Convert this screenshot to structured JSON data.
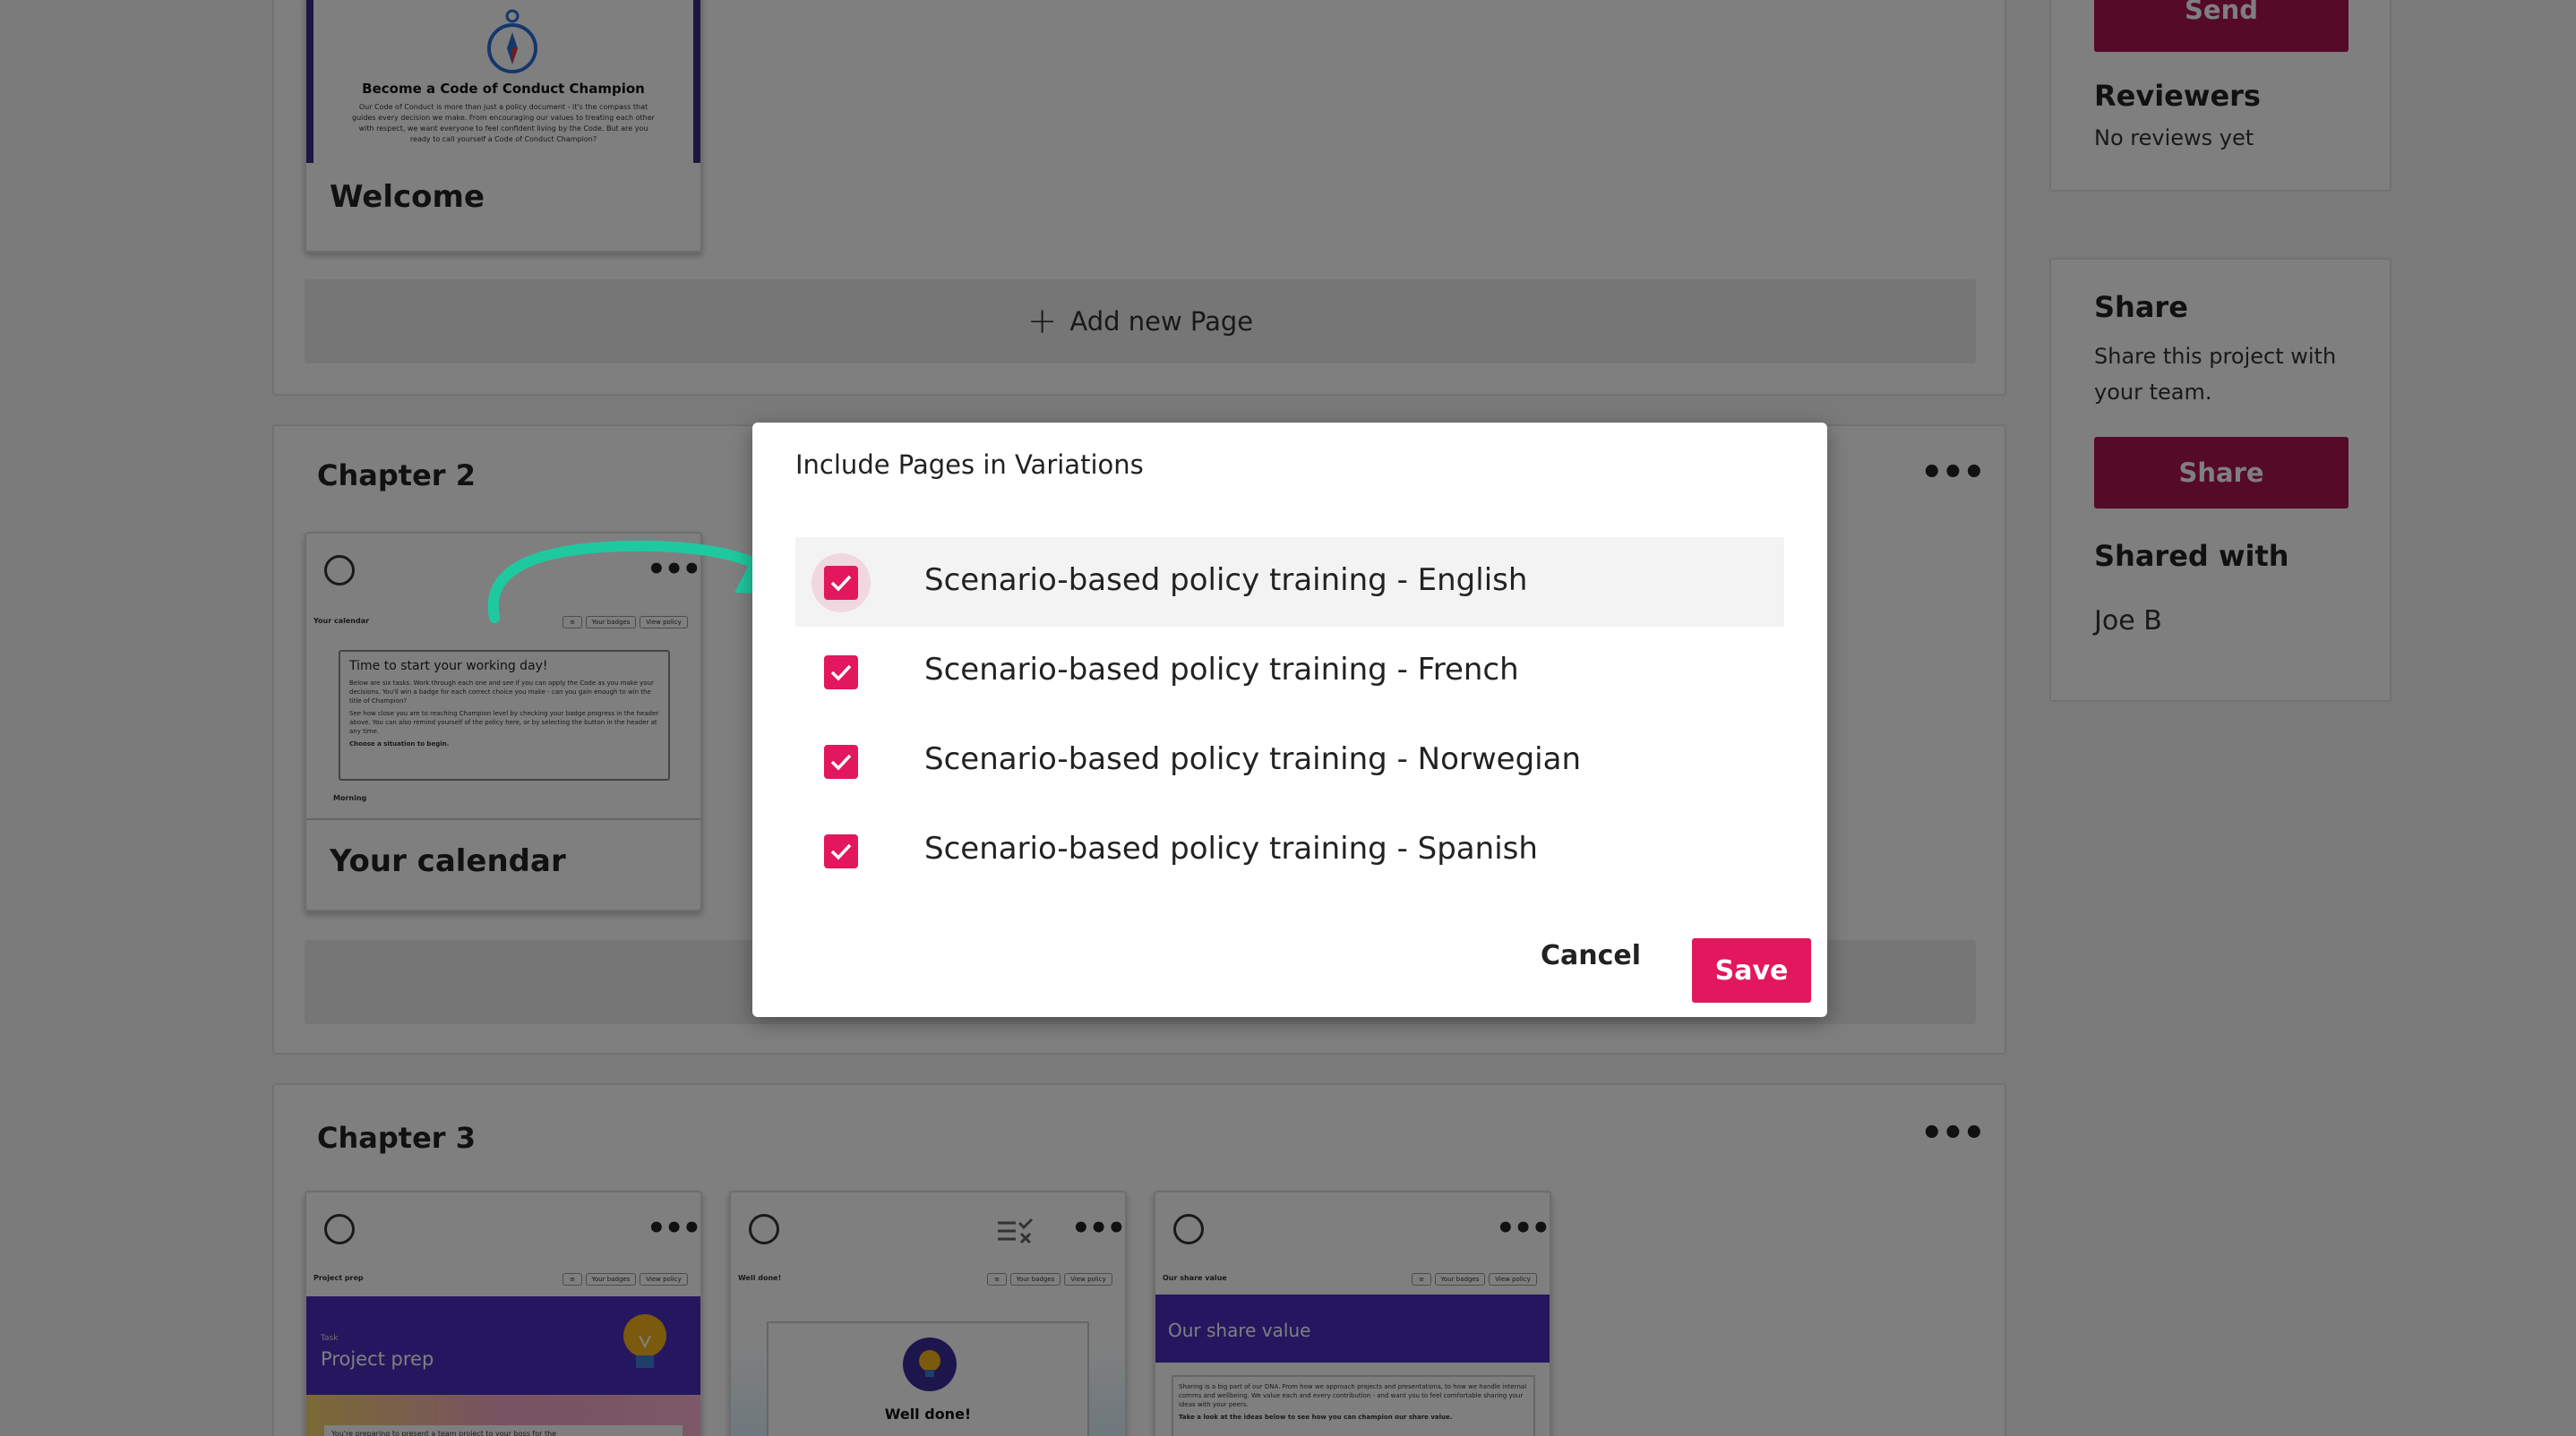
{
  "chapter1": {
    "welcome_card": {
      "thumb_heading": "Become a Code of Conduct Champion",
      "thumb_text": "Our Code of Conduct is more than just a policy document - it's the compass that guides every decision we make. From encouraging our values to treating each other with respect, we want everyone to feel confident living by the Code. But are you ready to call yourself a Code of Conduct Champion?",
      "title": "Welcome"
    },
    "add_page_label": "Add new Page"
  },
  "chapter2": {
    "title": "Chapter 2",
    "card": {
      "thumb_header": "Your calendar",
      "thumb_btn1": "Your badges",
      "thumb_btn2": "View policy",
      "thumb_box_title": "Time to start your working day!",
      "thumb_box_text": "Below are six tasks. Work through each one and see if you can apply the Code as you make your decisions. You'll win a badge for each correct choice you make - can you gain enough to win the title of Champion?",
      "thumb_box_text2": "See how close you are to reaching Champion level by checking your badge progress in the header above. You can also remind yourself of the policy here, or by selecting the button in the header at any time.",
      "thumb_box_cta": "Choose a situation to begin.",
      "thumb_footer": "Morning",
      "title": "Your calendar"
    }
  },
  "chapter3": {
    "title": "Chapter 3",
    "cards": [
      {
        "header": "Project prep",
        "btn1": "Your badges",
        "btn2": "View policy",
        "banner_small": "Task",
        "banner": "Project prep",
        "text": "You're preparing to present a team project to your boss for the"
      },
      {
        "header": "Well done!",
        "btn1": "Your badges",
        "btn2": "View policy",
        "banner": "Well done!"
      },
      {
        "header": "Our share value",
        "btn1": "Your badges",
        "btn2": "View policy",
        "banner": "Our share value",
        "text": "Sharing is a big part of our DNA. From how we approach projects and presentations, to how we handle internal comms and wellbeing. We value each and every contribution - and want you to feel comfortable sharing your ideas with your peers.",
        "text2": "Take a look at the ideas below to see how you can champion our share value."
      }
    ]
  },
  "sidebar": {
    "send_label": "Send",
    "reviewers_heading": "Reviewers",
    "reviewers_text": "No reviews yet",
    "share_heading": "Share",
    "share_text": "Share this project with your team.",
    "share_button": "Share",
    "shared_with_heading": "Shared with",
    "shared_with_user": "Joe B"
  },
  "dialog": {
    "title": "Include Pages in Variations",
    "options": [
      {
        "label": "Scenario-based policy training - English",
        "checked": true
      },
      {
        "label": "Scenario-based policy training - French",
        "checked": true
      },
      {
        "label": "Scenario-based policy training - Norwegian",
        "checked": true
      },
      {
        "label": "Scenario-based policy training - Spanish",
        "checked": true
      }
    ],
    "cancel_label": "Cancel",
    "save_label": "Save"
  },
  "colors": {
    "accent": "#e3175d",
    "sidebar_button": "#aa1450",
    "banner_purple": "#4a2fbf",
    "arrow": "#1fc9a0"
  }
}
